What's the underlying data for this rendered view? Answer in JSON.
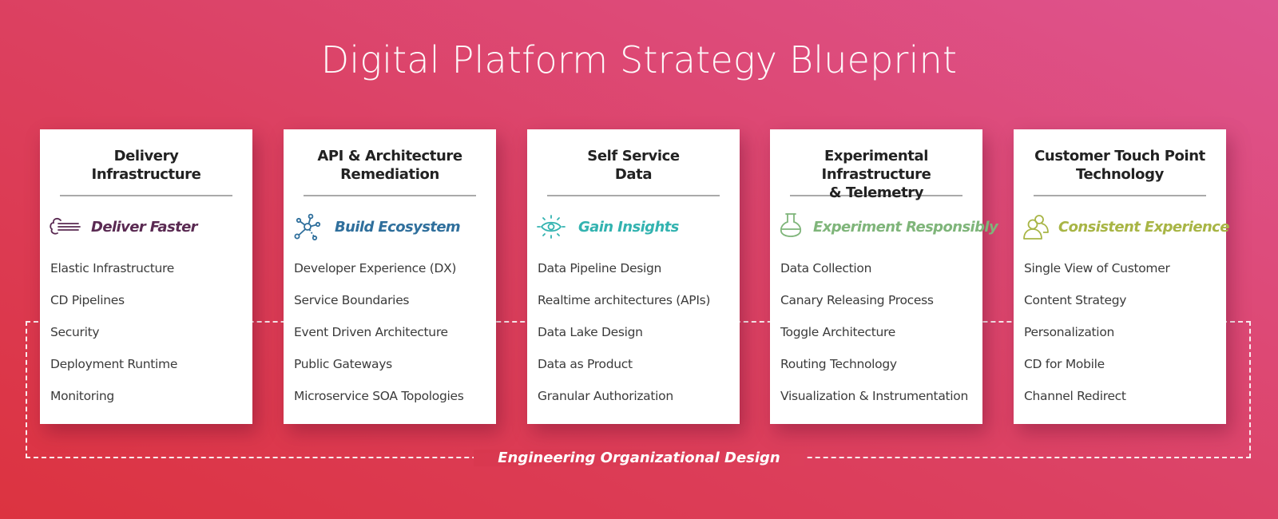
{
  "title": "Digital Platform Strategy Blueprint",
  "frame_label": "Engineering Organizational Design",
  "colors": {
    "background_start": "#dc3340",
    "background_end": "#de5490",
    "card_bg": "#ffffff",
    "divider": "#aaaaaa"
  },
  "cards": [
    {
      "title_line1": "Delivery",
      "title_line2": "Infrastructure",
      "theme": "Deliver Faster",
      "icon": "wind-cloud-icon",
      "accent": "#5a2a52",
      "items": [
        "Elastic Infrastructure",
        "CD Pipelines",
        "Security",
        "Deployment Runtime",
        "Monitoring"
      ]
    },
    {
      "title_line1": "API & Architecture",
      "title_line2": "Remediation",
      "theme": "Build Ecosystem",
      "icon": "network-hub-icon",
      "accent": "#2f6f9c",
      "items": [
        "Developer Experience (DX)",
        "Service Boundaries",
        "Event Driven Architecture",
        "Public Gateways",
        "Microservice SOA Topologies"
      ]
    },
    {
      "title_line1": "Self Service",
      "title_line2": "Data",
      "theme": "Gain Insights",
      "icon": "eye-insight-icon",
      "accent": "#33b3b0",
      "items": [
        "Data Pipeline Design",
        "Realtime architectures (APIs)",
        "Data Lake Design",
        "Data as Product",
        "Granular Authorization"
      ]
    },
    {
      "title_line1": "Experimental Infrastructure",
      "title_line2": "& Telemetry",
      "theme": "Experiment Responsibly",
      "icon": "flask-icon",
      "accent": "#7fb57a",
      "items": [
        "Data Collection",
        "Canary Releasing Process",
        "Toggle Architecture",
        "Routing Technology",
        "Visualization & Instrumentation"
      ]
    },
    {
      "title_line1": "Customer Touch Point",
      "title_line2": "Technology",
      "theme": "Consistent Experience",
      "icon": "users-icon",
      "accent": "#a8b545",
      "items": [
        "Single View of Customer",
        "Content Strategy",
        "Personalization",
        "CD for Mobile",
        "Channel Redirect"
      ]
    }
  ]
}
